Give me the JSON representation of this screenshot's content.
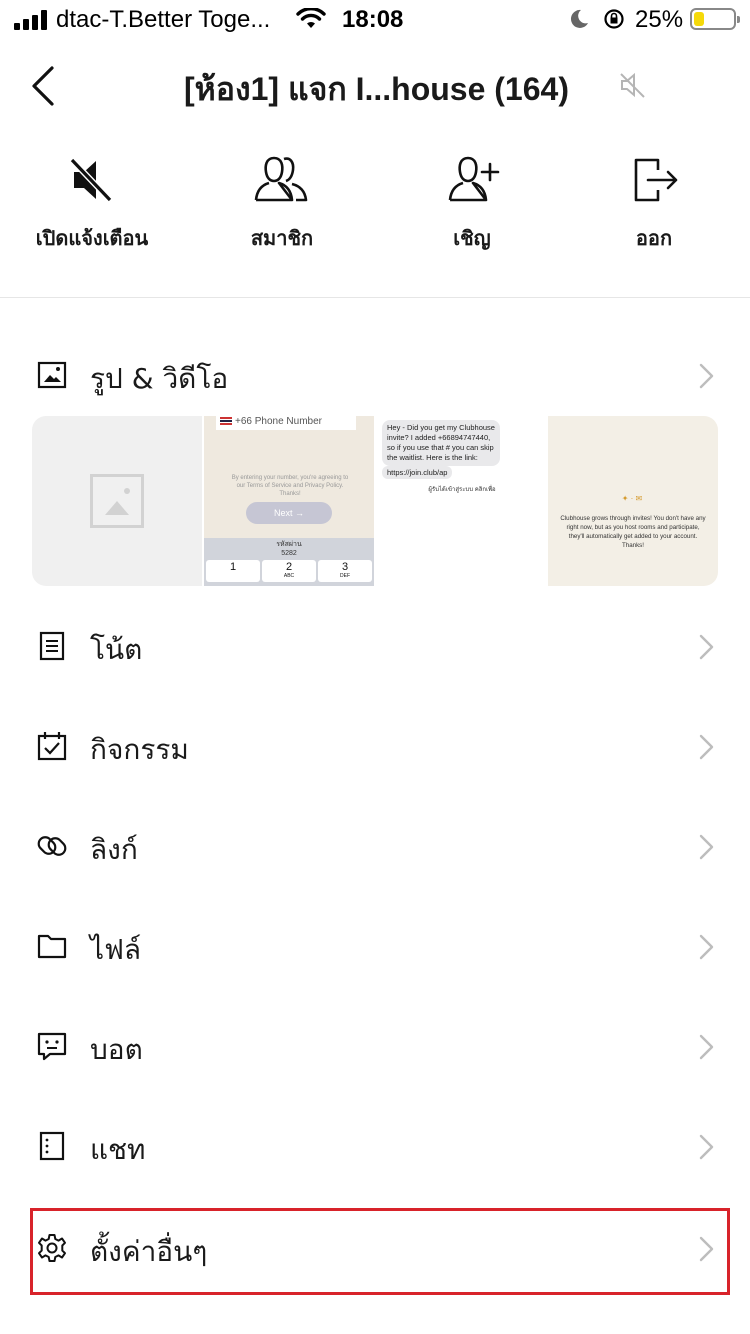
{
  "status_bar": {
    "carrier": "dtac-T.Better Toge...",
    "time": "18:08",
    "battery_percent": "25%",
    "battery_level": 0.25,
    "icons": [
      "signal-icon",
      "wifi-icon",
      "moon-icon",
      "rotation-lock-icon",
      "battery-icon"
    ]
  },
  "header": {
    "title": "[ห้อง1] แจก I...house (164)",
    "icons": [
      "back-icon",
      "muted-icon"
    ]
  },
  "actions": [
    {
      "label": "เปิดแจ้งเตือน",
      "icon": "speaker-muted-icon"
    },
    {
      "label": "สมาชิก",
      "icon": "members-icon"
    },
    {
      "label": "เชิญ",
      "icon": "add-person-icon"
    },
    {
      "label": "ออก",
      "icon": "leave-icon"
    }
  ],
  "media": {
    "label": "รูป & วิดีโอ",
    "icon": "image-icon",
    "thumb1": {
      "phone": "+66 Phone Number",
      "terms": "By entering your number, you're agreeing to our Terms of Service and Privacy Policy. Thanks!",
      "next": "Next →",
      "code_label": "รหัสผ่าน",
      "code": "5282",
      "keys": [
        {
          "num": "1",
          "letters": ""
        },
        {
          "num": "2",
          "letters": "ABC"
        },
        {
          "num": "3",
          "letters": "DEF"
        }
      ]
    },
    "thumb2": {
      "bubble": "Hey - Did you get my Clubhouse invite? I added +66894747440, so if you use that # you can skip the waitlist. Here is the link:",
      "link": "https://join.club/ap",
      "thai": "ผู้รับได้เข้าสู่ระบบ คลิกเพื่อ"
    },
    "thumb3": {
      "text": "Clubhouse grows through invites! You don't have any right now, but as you host rooms and participate, they'll automatically get added to your account. Thanks!"
    }
  },
  "menu": [
    {
      "label": "โน้ต",
      "icon": "note-icon"
    },
    {
      "label": "กิจกรรม",
      "icon": "calendar-check-icon"
    },
    {
      "label": "ลิงก์",
      "icon": "link-icon"
    },
    {
      "label": "ไฟล์",
      "icon": "folder-icon"
    },
    {
      "label": "บอต",
      "icon": "bot-icon"
    },
    {
      "label": "แชท",
      "icon": "chat-log-icon"
    },
    {
      "label": "ตั้งค่าอื่นๆ",
      "icon": "gear-icon"
    }
  ],
  "colors": {
    "highlight": "#d8232a",
    "text": "#1a1a1a",
    "chevron": "#bdbdbd",
    "battery": "#f5d90a"
  }
}
